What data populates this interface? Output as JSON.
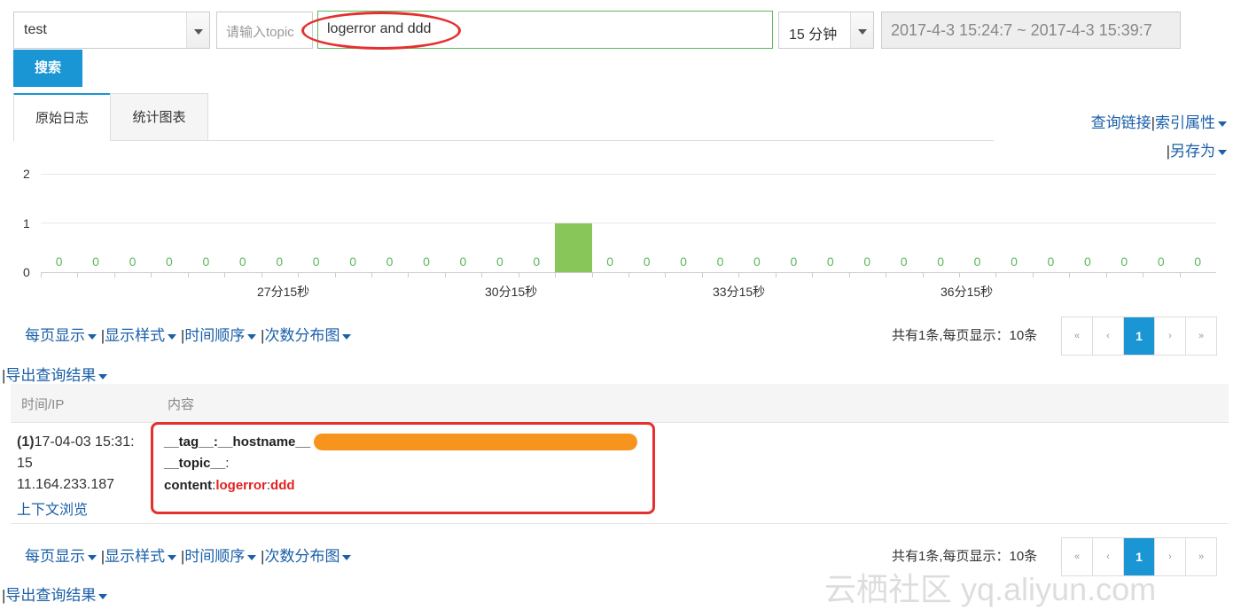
{
  "search": {
    "logstore_value": "test",
    "topic_placeholder": "请输入topic",
    "query_value": "logerror and ddd",
    "time_range_value": "15 分钟",
    "time_span_text": "2017-4-3 15:24:7 ~ 2017-4-3 15:39:7",
    "search_label": "搜索"
  },
  "tabs": [
    {
      "label": "原始日志"
    },
    {
      "label": "统计图表"
    }
  ],
  "right_menu": {
    "query_link": "查询链接",
    "index_attr": "索引属性",
    "save_as": "另存为",
    "separator": "|"
  },
  "chart_data": {
    "type": "bar",
    "y_ticks": [
      "0",
      "1",
      "2"
    ],
    "ylim": [
      0,
      2
    ],
    "x_tick_labels": [
      "27分15秒",
      "30分15秒",
      "33分15秒",
      "36分15秒"
    ],
    "values": [
      0,
      0,
      0,
      0,
      0,
      0,
      0,
      0,
      0,
      0,
      0,
      0,
      0,
      0,
      1,
      0,
      0,
      0,
      0,
      0,
      0,
      0,
      0,
      0,
      0,
      0,
      0,
      0,
      0,
      0,
      0,
      0
    ],
    "zero_label": "0",
    "bar_color": "#88c659"
  },
  "toolbar": {
    "per_page": "每页显示",
    "display_style": "显示样式",
    "time_order": "时间顺序",
    "count_dist": "次数分布图",
    "export": "导出查询结果",
    "separator": "|"
  },
  "pagination": {
    "summary": "共有1条,每页显示：10条",
    "first": "«",
    "prev": "‹",
    "current": "1",
    "next": "›",
    "last": "»"
  },
  "table": {
    "headers": [
      "时间/IP",
      "内容"
    ],
    "rows": [
      {
        "index": "(1)",
        "time": "17-04-03 15:31:",
        "time_cont": "15",
        "ip": "11.164.233.187",
        "context_link": "上下文浏览",
        "tag_key": "__tag__:__hostname__",
        "topic_key": "__topic__",
        "topic_sep": ":",
        "content_key": "content",
        "content_colon": ":",
        "content_v1": "logerror",
        "content_v2": "ddd"
      }
    ]
  },
  "watermark": "云栖社区 yq.aliyun.com",
  "colors": {
    "accent": "#1a96d4",
    "link": "#1a5fa8",
    "highlight": "#e2221e",
    "annotation": "#e53030",
    "redaction": "#f7941d"
  }
}
